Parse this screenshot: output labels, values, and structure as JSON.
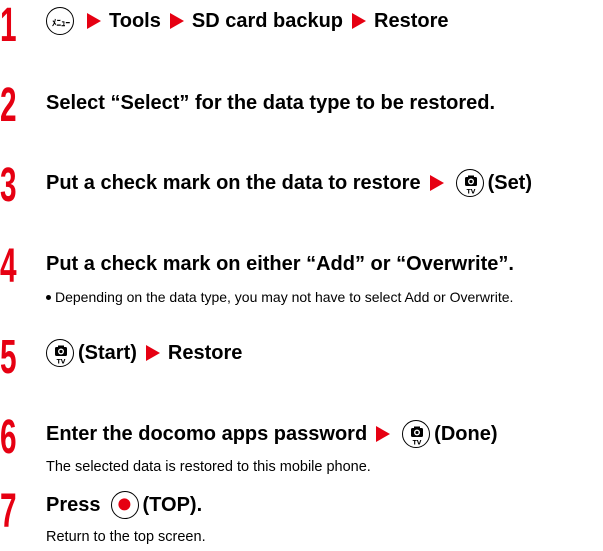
{
  "steps": [
    {
      "num": "1",
      "parts": {
        "t1": "Tools",
        "t2": "SD card backup",
        "t3": "Restore"
      }
    },
    {
      "num": "2",
      "text": "Select “Select” for the data type to be restored."
    },
    {
      "num": "3",
      "text": "Put a check mark on the data to restore",
      "key_label": "(Set)"
    },
    {
      "num": "4",
      "text": "Put a check mark on either “Add” or “Overwrite”.",
      "bullet": "Depending on the data type, you may not have to select Add or Overwrite."
    },
    {
      "num": "5",
      "key_label": "(Start)",
      "text2": "Restore"
    },
    {
      "num": "6",
      "text": "Enter the docomo apps password",
      "key_label": "(Done)",
      "sub": "The selected data is restored to this mobile phone."
    },
    {
      "num": "7",
      "text": "Press",
      "key_label": "(TOP).",
      "sub": "Return to the top screen."
    }
  ],
  "icons": {
    "menu": "menu-key-icon",
    "camera": "camera-tv-key-icon",
    "center": "center-key-icon",
    "arrow": "red-triangle-arrow"
  },
  "colors": {
    "accent": "#e60012"
  }
}
